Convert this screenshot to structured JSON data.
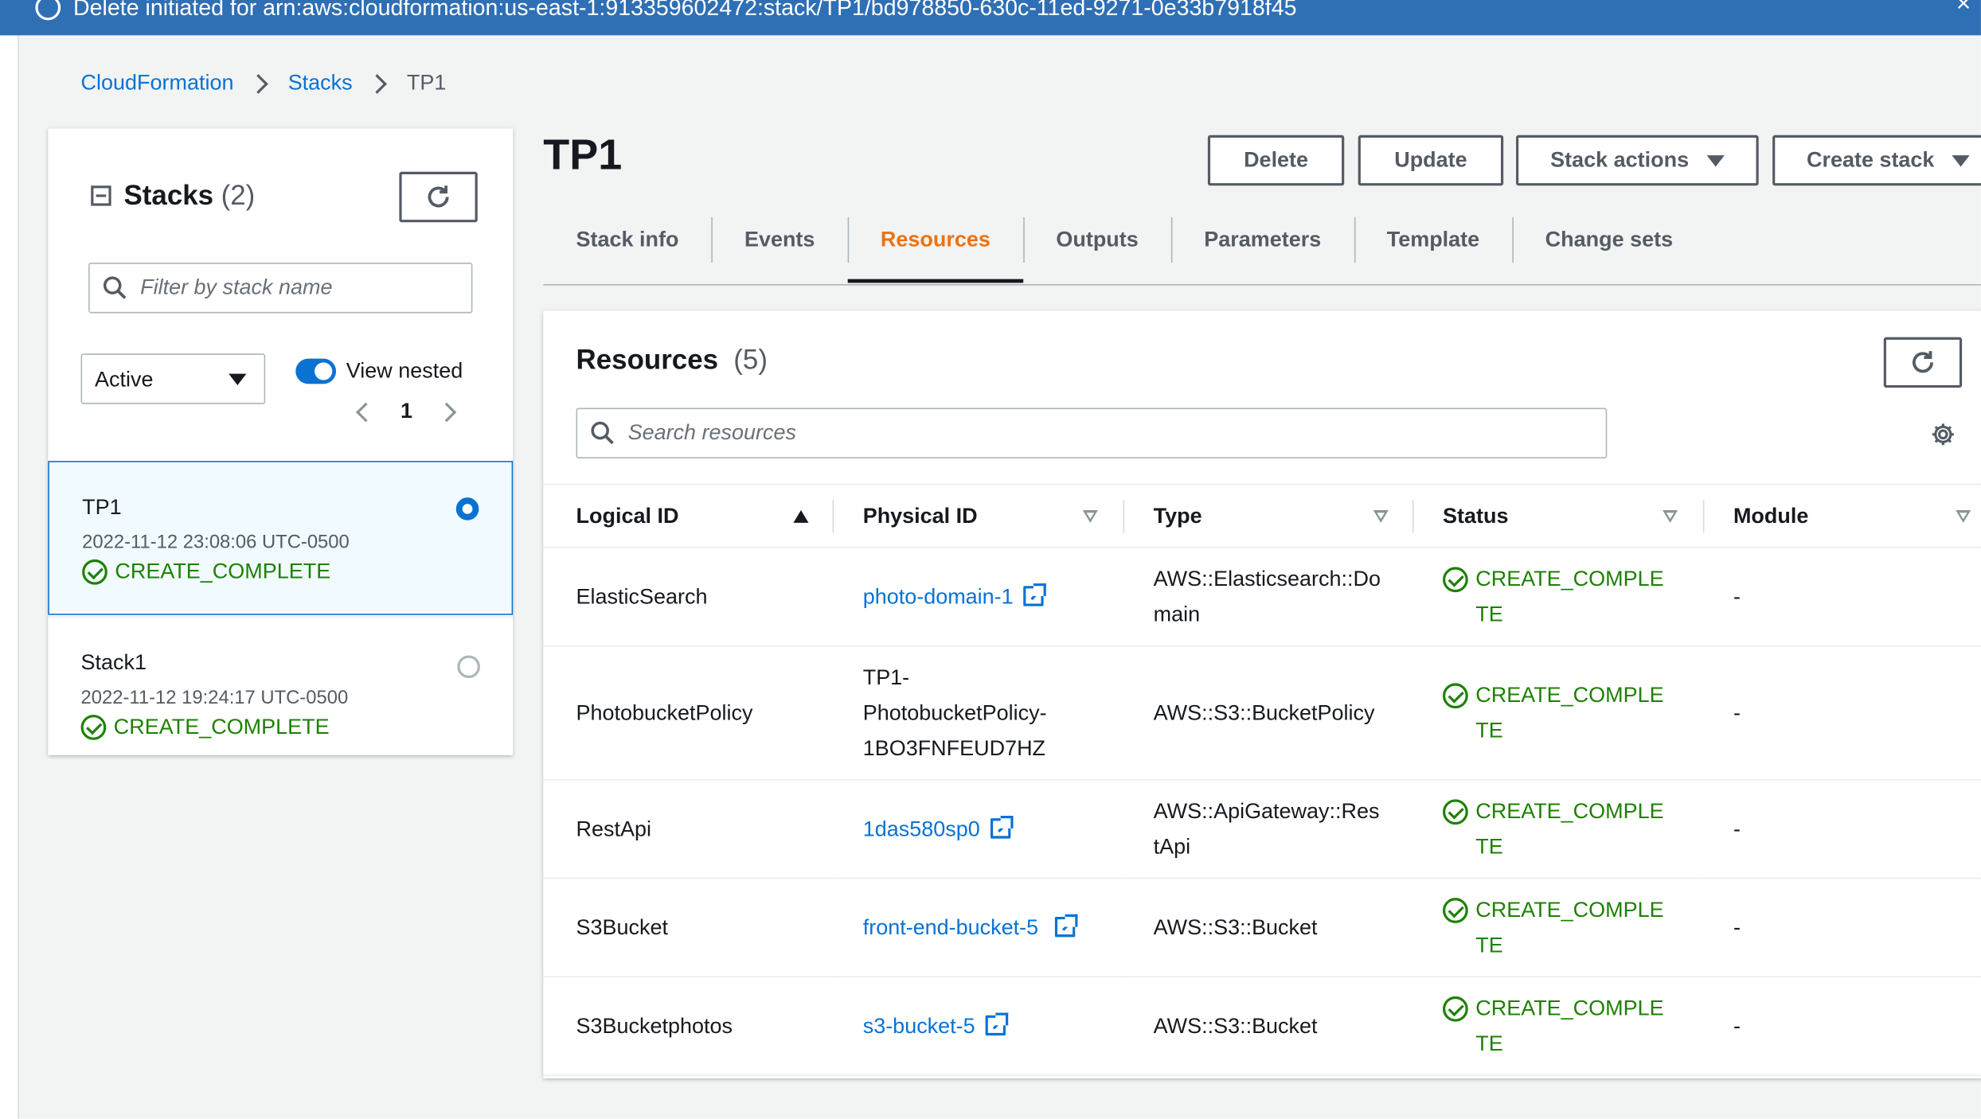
{
  "flash": {
    "text": "Delete initiated for arn:aws:cloudformation:us-east-1:913359602472:stack/TP1/bd978850-630c-11ed-9271-0e33b7918f45"
  },
  "breadcrumb": {
    "root": "CloudFormation",
    "stacks": "Stacks",
    "current": "TP1"
  },
  "stacks_panel": {
    "title": "Stacks",
    "count": "(2)",
    "filter_placeholder": "Filter by stack name",
    "status_filter": "Active",
    "view_nested_label": "View nested",
    "page": "1",
    "stacks": [
      {
        "name": "TP1",
        "date": "2022-11-12 23:08:06 UTC-0500",
        "status": "CREATE_COMPLETE",
        "selected": true
      },
      {
        "name": "Stack1",
        "date": "2022-11-12 19:24:17 UTC-0500",
        "status": "CREATE_COMPLETE",
        "selected": false
      }
    ]
  },
  "page": {
    "title": "TP1",
    "buttons": {
      "delete": "Delete",
      "update": "Update",
      "stack_actions": "Stack actions",
      "create_stack": "Create stack"
    },
    "tabs": [
      "Stack info",
      "Events",
      "Resources",
      "Outputs",
      "Parameters",
      "Template",
      "Change sets"
    ],
    "active_tab": "Resources"
  },
  "resources": {
    "title": "Resources",
    "count": "(5)",
    "search_placeholder": "Search resources",
    "columns": [
      "Logical ID",
      "Physical ID",
      "Type",
      "Status",
      "Module"
    ],
    "rows": [
      {
        "logical_id": "ElasticSearch",
        "physical_id": "photo-domain-1",
        "physical_link": true,
        "type": "AWS::Elasticsearch::Domain",
        "status": "CREATE_COMPLETE",
        "module": "-"
      },
      {
        "logical_id": "PhotobucketPolicy",
        "physical_id": "TP1-PhotobucketPolicy-1BO3FNFEUD7HZ",
        "physical_link": false,
        "type": "AWS::S3::BucketPolicy",
        "status": "CREATE_COMPLETE",
        "module": "-"
      },
      {
        "logical_id": "RestApi",
        "physical_id": "1das580sp0",
        "physical_link": true,
        "type": "AWS::ApiGateway::RestApi",
        "status": "CREATE_COMPLETE",
        "module": "-"
      },
      {
        "logical_id": "S3Bucket",
        "physical_id": "front-end-bucket-5",
        "physical_link": true,
        "type": "AWS::S3::Bucket",
        "status": "CREATE_COMPLETE",
        "module": "-"
      },
      {
        "logical_id": "S3Bucketphotos",
        "physical_id": "s3-bucket-5",
        "physical_link": true,
        "type": "AWS::S3::Bucket",
        "status": "CREATE_COMPLETE",
        "module": "-"
      }
    ]
  },
  "colors": {
    "primary_blue": "#0972d3",
    "success_green": "#1d8102",
    "active_tab_orange": "#ec7211",
    "flash_blue": "#2f6fb5"
  }
}
